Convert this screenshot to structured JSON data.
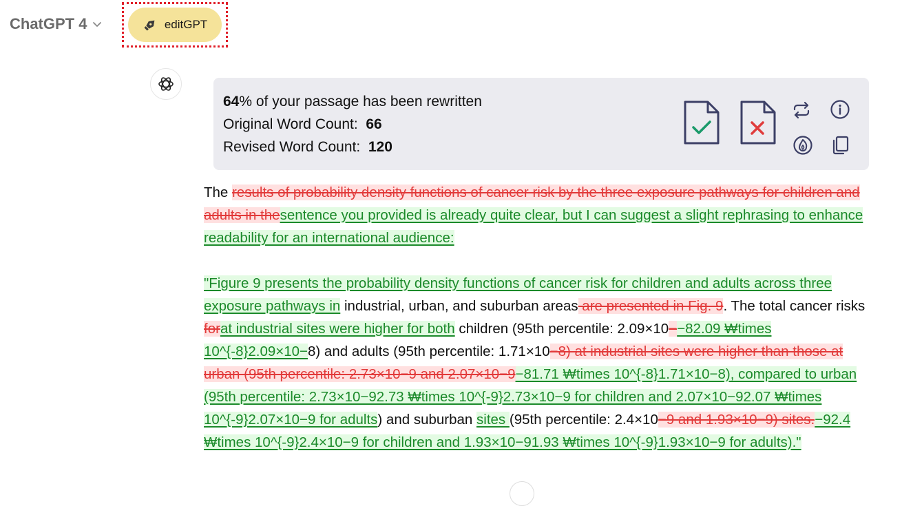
{
  "header": {
    "model_name": "ChatGPT 4",
    "edit_button_label": "editGPT"
  },
  "panel": {
    "percent": "64",
    "percent_suffix": "% of your passage has been rewritten",
    "original_label": "Original Word Count:",
    "original_count": "66",
    "revised_label": "Revised Word Count:",
    "revised_count": "120"
  },
  "icons": {
    "accept": "accept-document-icon",
    "reject": "reject-document-icon",
    "regenerate": "repeat-icon",
    "info": "info-icon",
    "fire": "fire-icon",
    "copy": "copy-icon"
  },
  "colors": {
    "deleted_text": "#e23a3a",
    "deleted_bg": "#ffe0e0",
    "inserted_text": "#1b8a2a",
    "inserted_bg": "#e3fbe3",
    "edit_button_bg": "#f5e39a",
    "highlight_border": "#e0202a"
  },
  "diff": {
    "paragraphs": [
      [
        {
          "t": "plain",
          "s": "The "
        },
        {
          "t": "del",
          "s": "results of probability density functions of cancer risk by the three exposure pathways for children and adults in the"
        },
        {
          "t": "ins",
          "s": "sentence you provided is already quite clear, but I can suggest a slight rephrasing to enhance readability for an international audience:"
        }
      ],
      [
        {
          "t": "ins",
          "s": "\"Figure 9 presents the probability density functions of cancer risk for children and adults across three exposure pathways in"
        },
        {
          "t": "plain",
          "s": " industrial, urban, and suburban areas"
        },
        {
          "t": "del",
          "s": " are presented in Fig. 9"
        },
        {
          "t": "plain",
          "s": ". The total cancer risks "
        },
        {
          "t": "del",
          "s": "for"
        },
        {
          "t": "ins",
          "s": "at industrial sites were higher for both"
        },
        {
          "t": "plain",
          "s": " children (95th percentile: 2.09×10"
        },
        {
          "t": "del",
          "s": "−"
        },
        {
          "t": "ins",
          "s": "−82.09 ₩times 10^{-8}2.09×10−"
        },
        {
          "t": "plain",
          "s": "8) and adults (95th percentile: 1.71×10"
        },
        {
          "t": "del",
          "s": "−8) at industrial sites were higher than those at urban (95th percentile: 2.73×10−9 and 2.07×10−9"
        },
        {
          "t": "ins",
          "s": "−81.71 ₩times 10^{-8}1.71×10−8), compared to urban (95th percentile: 2.73×10−92.73 ₩times 10^{-9}2.73×10−9 for children and 2.07×10−92.07 ₩times 10^{-9}2.07×10−9 for adults"
        },
        {
          "t": "plain",
          "s": ") and suburban "
        },
        {
          "t": "ins",
          "s": "sites "
        },
        {
          "t": "plain",
          "s": "(95th percentile: 2.4×10"
        },
        {
          "t": "del",
          "s": "−9 and 1.93×10−9) sites."
        },
        {
          "t": "ins",
          "s": "−92.4 ₩times 10^{-9}2.4×10−9 for children and 1.93×10−91.93 ₩times 10^{-9}1.93×10−9 for adults).\""
        }
      ]
    ]
  }
}
